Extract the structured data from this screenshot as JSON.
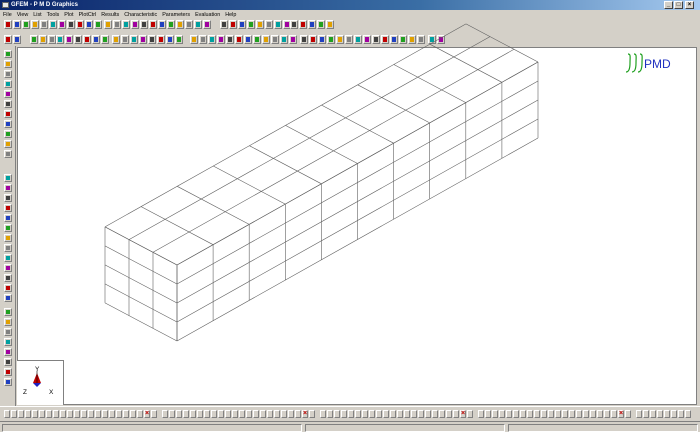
{
  "window": {
    "title": "GFEM - P M D Graphics",
    "minimize_glyph": "_",
    "maximize_glyph": "□",
    "close_glyph": "×"
  },
  "menu": [
    "File",
    "View",
    "List",
    "Tools",
    "Plot",
    "PlotCtrl",
    "Results",
    "Characteristic",
    "Parameters",
    "Evaluation",
    "Help"
  ],
  "logo": {
    "text": "PMD",
    "color": "#2030c0",
    "symbol_color": "#20a020"
  },
  "triad": {
    "y": "Y",
    "z": "Z",
    "x": "X"
  },
  "mesh": {
    "length_divisions": 10,
    "width_divisions": 3,
    "height_divisions": 4
  },
  "colors": {
    "mesh_line": "#606060",
    "titlebar_start": "#0a246a",
    "titlebar_end": "#a6caf0"
  },
  "icons": {
    "toolbar1": [
      "select-icon",
      "node-icon",
      "element-icon",
      "material-icon",
      "undo-icon",
      "redo-icon",
      "zoom-icon",
      "pan-icon",
      "rotate-icon",
      "arrow-icon"
    ],
    "toolbar2": [
      "view-icon",
      "mesh-icon",
      "color-icon",
      "arrow-left-icon",
      "measure-icon",
      "settings-icon"
    ],
    "left": [
      "pointer-icon",
      "node-icon",
      "line-icon",
      "surface-icon",
      "volume-icon",
      "load-icon",
      "support-icon"
    ]
  }
}
